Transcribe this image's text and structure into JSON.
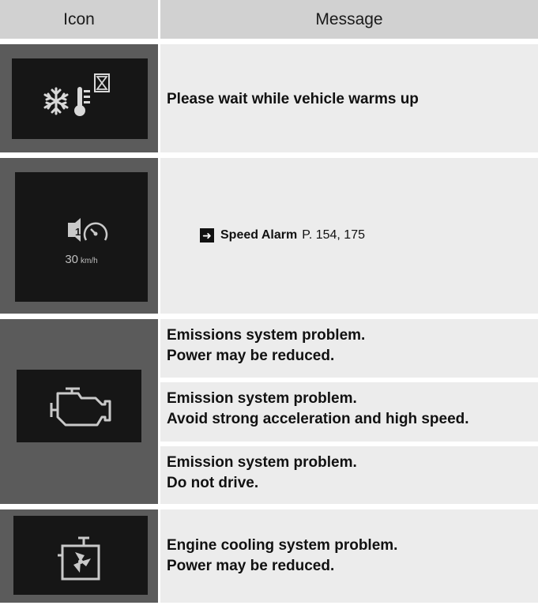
{
  "header": {
    "icon_col": "Icon",
    "message_col": "Message"
  },
  "rows": [
    {
      "icon": "warm-up-snowflake-thermometer-hourglass-icon",
      "message": "Please wait while vehicle warms up"
    },
    {
      "icon": "speed-alarm-icon",
      "speed_value": "30",
      "speed_unit": "km/h",
      "reference": {
        "label": "Speed Alarm",
        "pages": "P. 154, 175"
      }
    },
    {
      "icon": "check-engine-icon",
      "messages": [
        {
          "line1": "Emissions system problem.",
          "line2": "Power may be reduced."
        },
        {
          "line1": "Emission system problem.",
          "line2": "Avoid strong acceleration and high speed."
        },
        {
          "line1": "Emission system problem.",
          "line2": "Do not drive."
        }
      ]
    },
    {
      "icon": "engine-cooling-problem-icon",
      "line1": "Engine cooling system problem.",
      "line2": "Power may be reduced."
    }
  ]
}
